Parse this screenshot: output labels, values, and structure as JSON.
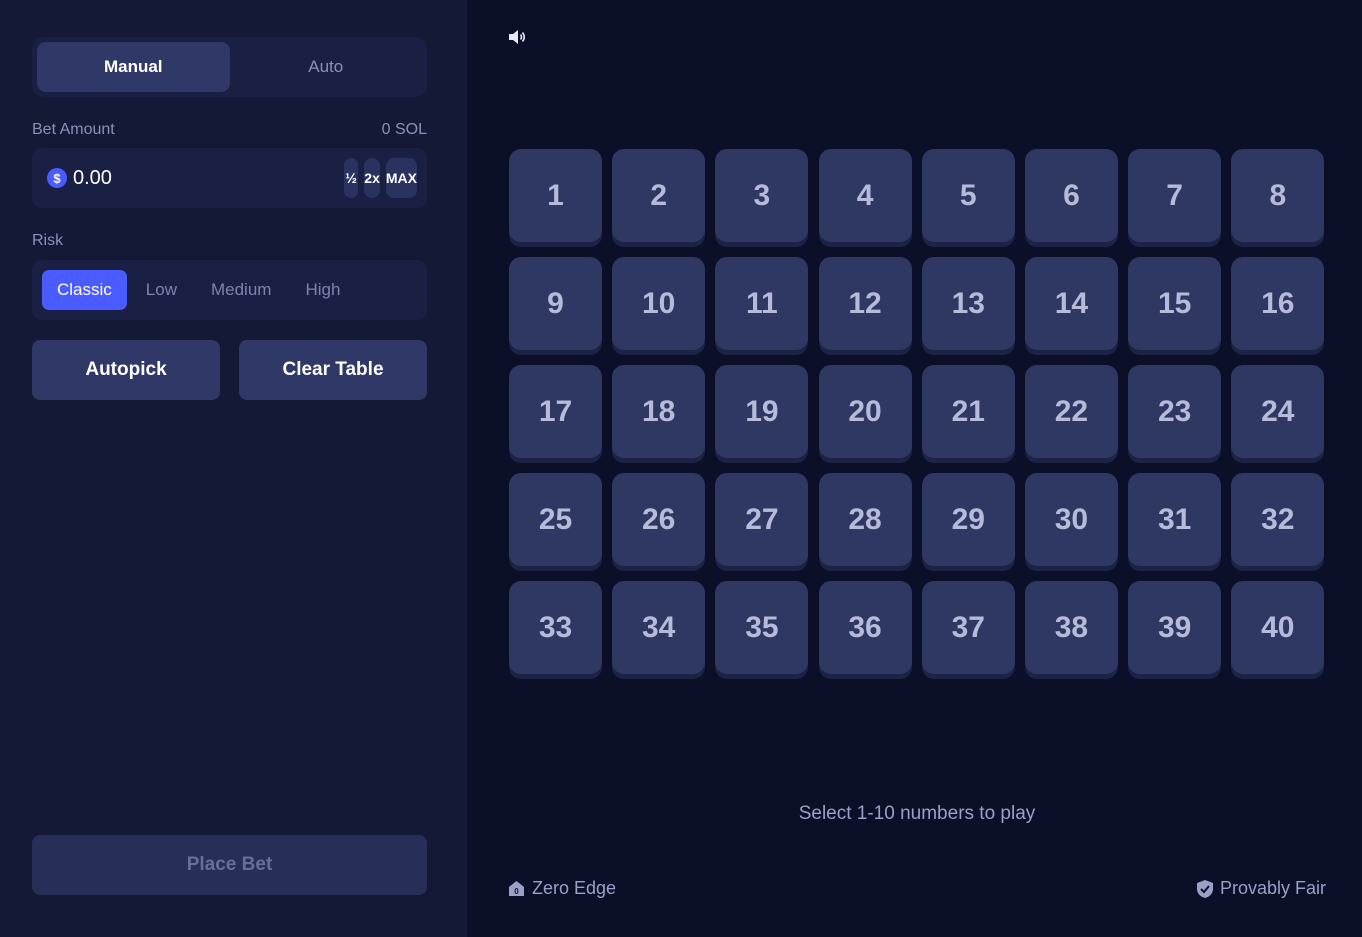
{
  "sidebar": {
    "mode_tabs": [
      {
        "label": "Manual",
        "active": true
      },
      {
        "label": "Auto",
        "active": false
      }
    ],
    "bet_amount_label": "Bet Amount",
    "balance": "0 SOL",
    "currency_symbol": "$",
    "bet_value": "0.00",
    "half_label": "½",
    "double_label": "2x",
    "max_label": "MAX",
    "risk_label": "Risk",
    "risk_tabs": [
      {
        "label": "Classic",
        "active": true
      },
      {
        "label": "Low",
        "active": false
      },
      {
        "label": "Medium",
        "active": false
      },
      {
        "label": "High",
        "active": false
      }
    ],
    "autopick_label": "Autopick",
    "clear_table_label": "Clear Table",
    "place_bet_label": "Place Bet"
  },
  "main": {
    "sound_icon": "speaker-icon",
    "tiles": [
      "1",
      "2",
      "3",
      "4",
      "5",
      "6",
      "7",
      "8",
      "9",
      "10",
      "11",
      "12",
      "13",
      "14",
      "15",
      "16",
      "17",
      "18",
      "19",
      "20",
      "21",
      "22",
      "23",
      "24",
      "25",
      "26",
      "27",
      "28",
      "29",
      "30",
      "31",
      "32",
      "33",
      "34",
      "35",
      "36",
      "37",
      "38",
      "39",
      "40"
    ],
    "hint": "Select 1-10 numbers to play",
    "footer_left": "Zero Edge",
    "footer_right": "Provably Fair"
  },
  "colors": {
    "background": "#0b0f27",
    "sidebar": "#141a36",
    "accent": "#4a5cff",
    "tile": "#2f3863"
  }
}
